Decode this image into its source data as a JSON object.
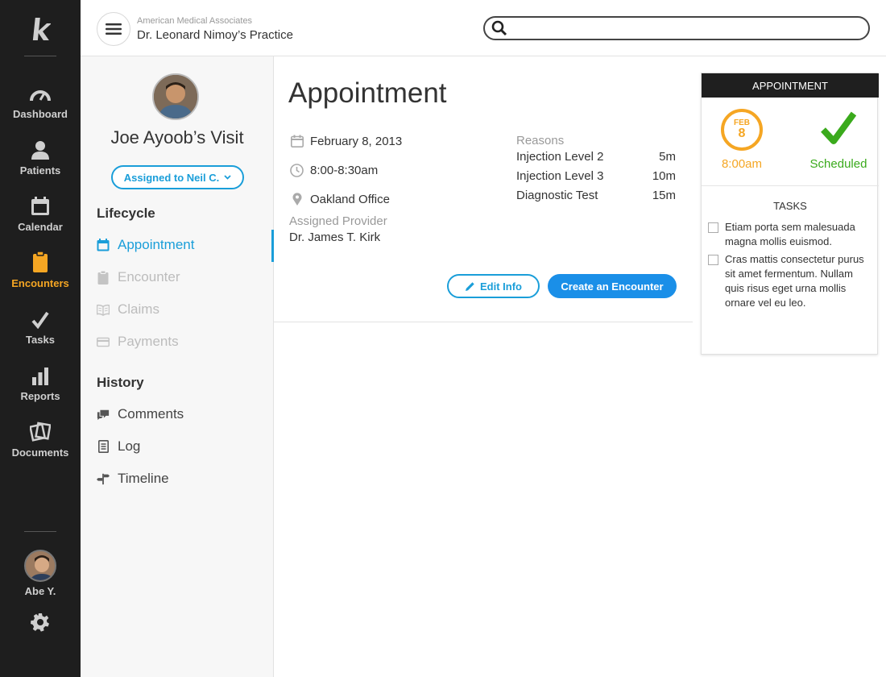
{
  "nav": {
    "items": [
      {
        "label": "Dashboard",
        "icon": "speedometer-icon"
      },
      {
        "label": "Patients",
        "icon": "person-icon"
      },
      {
        "label": "Calendar",
        "icon": "calendar-icon"
      },
      {
        "label": "Encounters",
        "icon": "clipboard-icon",
        "active": true
      },
      {
        "label": "Tasks",
        "icon": "checkmark-icon"
      },
      {
        "label": "Reports",
        "icon": "bar-chart-icon"
      },
      {
        "label": "Documents",
        "icon": "documents-icon"
      }
    ],
    "user_name": "Abe Y."
  },
  "header": {
    "practice_org": "American Medical Associates",
    "practice_name": "Dr. Leonard Nimoy’s Practice",
    "search_placeholder": ""
  },
  "visit": {
    "title": "Joe Ayoob’s Visit",
    "assigned_label": "Assigned to Neil C.",
    "lifecycle_heading": "Lifecycle",
    "lifecycle_items": [
      {
        "label": "Appointment",
        "state": "active"
      },
      {
        "label": "Encounter",
        "state": "disabled"
      },
      {
        "label": "Claims",
        "state": "disabled"
      },
      {
        "label": "Payments",
        "state": "disabled"
      }
    ],
    "history_heading": "History",
    "history_items": [
      {
        "label": "Comments"
      },
      {
        "label": "Log"
      },
      {
        "label": "Timeline"
      }
    ]
  },
  "appointment": {
    "title": "Appointment",
    "date": "February 8, 2013",
    "time": "8:00-8:30am",
    "location": "Oakland Office",
    "provider_label": "Assigned Provider",
    "provider": "Dr. James T. Kirk",
    "reasons_label": "Reasons",
    "reasons": [
      {
        "name": "Injection Level 2",
        "duration": "5m"
      },
      {
        "name": "Injection Level 3",
        "duration": "10m"
      },
      {
        "name": "Diagnostic Test",
        "duration": "15m"
      }
    ],
    "edit_label": "Edit Info",
    "create_label": "Create an Encounter"
  },
  "card": {
    "heading": "APPOINTMENT",
    "month": "FEB",
    "day": "8",
    "time": "8:00am",
    "status": "Scheduled",
    "tasks_heading": "TASKS",
    "tasks": [
      {
        "text": "Etiam porta sem malesuada magna mollis euismod."
      },
      {
        "text": "Cras mattis consectetur purus sit amet fermentum. Nullam quis risus eget urna mollis ornare vel eu leo."
      }
    ]
  },
  "colors": {
    "accent_blue": "#1a9ed9",
    "active_orange": "#f5a623",
    "success_green": "#3aaa1c",
    "nav_bg": "#1e1e1e"
  }
}
